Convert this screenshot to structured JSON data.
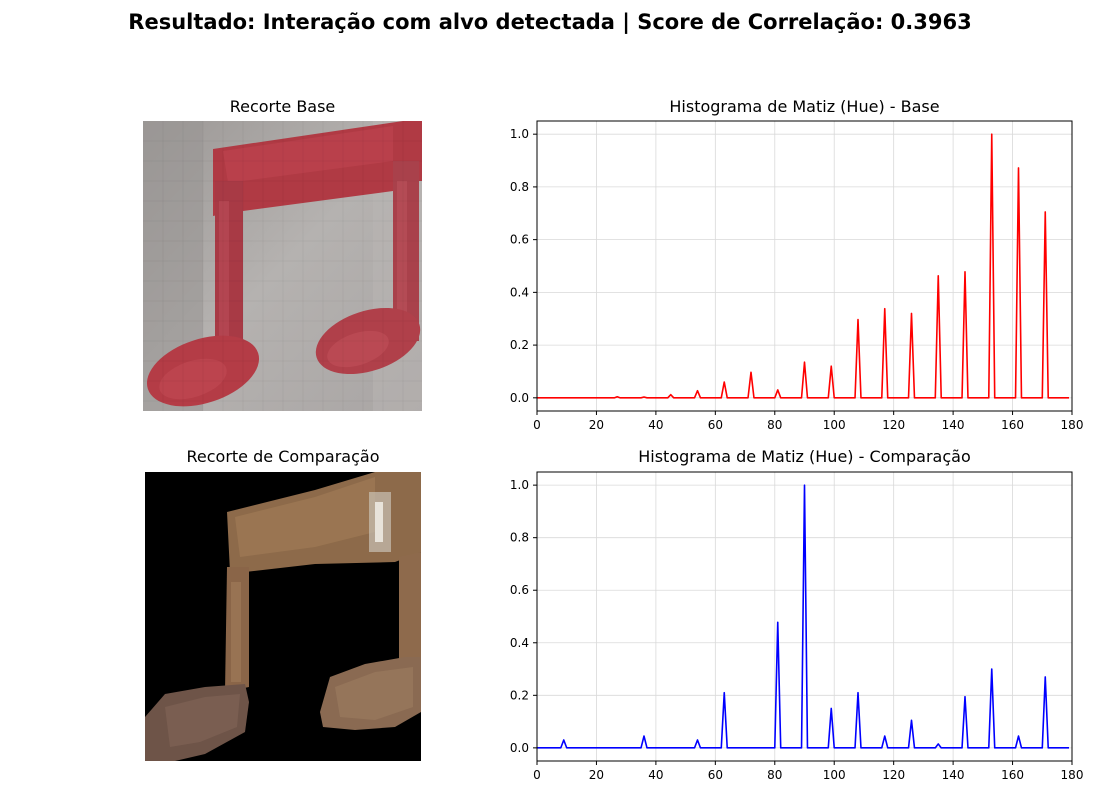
{
  "suptitle": "Resultado: Interação com alvo detectada | Score de Correlação: 0.3963",
  "panels": {
    "base_image_title": "Recorte Base",
    "compare_image_title": "Recorte de Comparação"
  },
  "colors": {
    "base_series": "#ff0000",
    "compare_series": "#0000ff",
    "grid": "#d9d9d9"
  },
  "chart_data": [
    {
      "type": "line",
      "title": "Histograma de Matiz (Hue) - Base",
      "xlabel": "",
      "ylabel": "",
      "xlim": [
        0,
        180
      ],
      "ylim": [
        -0.05,
        1.05
      ],
      "xticks": [
        0,
        20,
        40,
        60,
        80,
        100,
        120,
        140,
        160,
        180
      ],
      "yticks": [
        0.0,
        0.2,
        0.4,
        0.6,
        0.8,
        1.0
      ],
      "grid": true,
      "color": "#ff0000",
      "x_range": [
        0,
        179
      ],
      "peaks": [
        [
          27,
          0.004
        ],
        [
          36,
          0.003
        ],
        [
          45,
          0.012
        ],
        [
          54,
          0.027
        ],
        [
          63,
          0.06
        ],
        [
          72,
          0.097
        ],
        [
          81,
          0.03
        ],
        [
          90,
          0.135
        ],
        [
          99,
          0.12
        ],
        [
          108,
          0.297
        ],
        [
          117,
          0.338
        ],
        [
          126,
          0.32
        ],
        [
          135,
          0.463
        ],
        [
          144,
          0.478
        ],
        [
          153,
          1.0
        ],
        [
          162,
          0.872
        ],
        [
          171,
          0.705
        ]
      ]
    },
    {
      "type": "line",
      "title": "Histograma de Matiz (Hue) - Comparação",
      "xlabel": "",
      "ylabel": "",
      "xlim": [
        0,
        180
      ],
      "ylim": [
        -0.05,
        1.05
      ],
      "xticks": [
        0,
        20,
        40,
        60,
        80,
        100,
        120,
        140,
        160,
        180
      ],
      "yticks": [
        0.0,
        0.2,
        0.4,
        0.6,
        0.8,
        1.0
      ],
      "grid": true,
      "color": "#0000ff",
      "x_range": [
        0,
        179
      ],
      "peaks": [
        [
          9,
          0.03
        ],
        [
          36,
          0.045
        ],
        [
          54,
          0.03
        ],
        [
          63,
          0.21
        ],
        [
          81,
          0.478
        ],
        [
          90,
          1.0
        ],
        [
          99,
          0.15
        ],
        [
          108,
          0.21
        ],
        [
          117,
          0.045
        ],
        [
          126,
          0.105
        ],
        [
          135,
          0.015
        ],
        [
          144,
          0.195
        ],
        [
          153,
          0.3
        ],
        [
          162,
          0.045
        ],
        [
          171,
          0.27
        ]
      ]
    }
  ]
}
